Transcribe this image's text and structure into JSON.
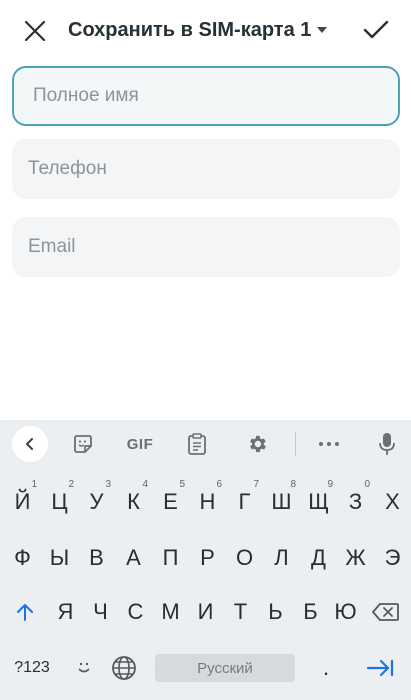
{
  "header": {
    "title": "Сохранить в SIM-карта 1",
    "close_icon": "close-icon",
    "done_icon": "check-icon"
  },
  "form": {
    "name_placeholder": "Полное имя",
    "phone_placeholder": "Телефон",
    "email_placeholder": "Email",
    "name_value": "",
    "phone_value": "",
    "email_value": ""
  },
  "keyboard": {
    "toolbar": {
      "back_icon": "chevron-left-icon",
      "sticker_icon": "sticker-icon",
      "gif_label": "GIF",
      "clipboard_icon": "clipboard-icon",
      "settings_icon": "gear-icon",
      "more_icon": "more-icon",
      "mic_icon": "microphone-icon"
    },
    "row1": [
      {
        "label": "Й",
        "hint": "1"
      },
      {
        "label": "Ц",
        "hint": "2"
      },
      {
        "label": "У",
        "hint": "3"
      },
      {
        "label": "К",
        "hint": "4"
      },
      {
        "label": "Е",
        "hint": "5"
      },
      {
        "label": "Н",
        "hint": "6"
      },
      {
        "label": "Г",
        "hint": "7"
      },
      {
        "label": "Ш",
        "hint": "8"
      },
      {
        "label": "Щ",
        "hint": "9"
      },
      {
        "label": "З",
        "hint": "0"
      },
      {
        "label": "Х",
        "hint": ""
      }
    ],
    "row2": [
      "Ф",
      "Ы",
      "В",
      "А",
      "П",
      "Р",
      "О",
      "Л",
      "Д",
      "Ж",
      "Э"
    ],
    "row3": [
      "Я",
      "Ч",
      "С",
      "М",
      "И",
      "Т",
      "Ь",
      "Б",
      "Ю"
    ],
    "symbols_label": "?123",
    "emoji_icon": "emoji-icon",
    "globe_icon": "globe-icon",
    "space_label": "Русский",
    "period_label": ".",
    "shift_icon": "shift-icon",
    "backspace_icon": "backspace-icon",
    "enter_icon": "tab-next-icon",
    "accent_color": "#1a73e8"
  }
}
